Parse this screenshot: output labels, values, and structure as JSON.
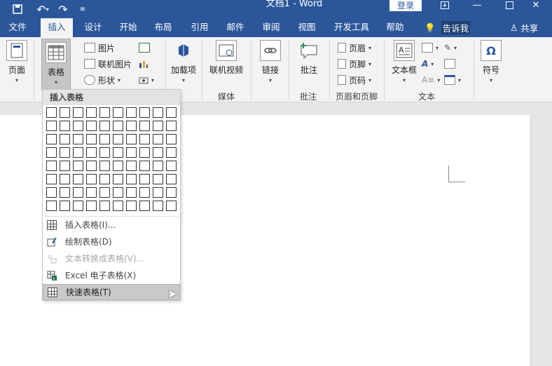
{
  "titlebar": {
    "title": "文档1  -  Word",
    "login": "登录",
    "quick_access": [
      "save-icon",
      "undo-icon",
      "redo-icon",
      "customize-icon"
    ]
  },
  "tabs": [
    {
      "label": "文件",
      "active": false
    },
    {
      "label": "插入",
      "active": true
    },
    {
      "label": "设计",
      "active": false
    },
    {
      "label": "开始",
      "active": false
    },
    {
      "label": "布局",
      "active": false
    },
    {
      "label": "引用",
      "active": false
    },
    {
      "label": "邮件",
      "active": false
    },
    {
      "label": "审阅",
      "active": false
    },
    {
      "label": "视图",
      "active": false
    },
    {
      "label": "开发工具",
      "active": false
    },
    {
      "label": "帮助",
      "active": false
    }
  ],
  "tell_me": "告诉我",
  "share": "共享",
  "ribbon": {
    "page": "页面",
    "table": "表格",
    "picture": "图片",
    "online_picture": "联机图片",
    "shapes": "形状",
    "addins": "加载项",
    "online_video": "联机视频",
    "media_group": "媒体",
    "link": "链接",
    "comment": "批注",
    "comment_group": "批注",
    "header": "页眉",
    "footer": "页脚",
    "page_number": "页码",
    "header_footer_group": "页眉和页脚",
    "textbox": "文本框",
    "text_group": "文本",
    "symbol": "符号"
  },
  "dropdown": {
    "header": "插入表格",
    "grid_cols": 10,
    "grid_rows": 8,
    "items": [
      {
        "label": "插入表格(I)...",
        "disabled": false,
        "icon": "table-icon"
      },
      {
        "label": "绘制表格(D)",
        "disabled": false,
        "icon": "draw-table-icon"
      },
      {
        "label": "文本转换成表格(V)...",
        "disabled": true,
        "icon": "convert-text-icon"
      },
      {
        "label": "Excel 电子表格(X)",
        "disabled": false,
        "icon": "excel-icon"
      },
      {
        "label": "快速表格(T)",
        "disabled": false,
        "icon": "quick-table-icon",
        "hover": true
      }
    ]
  }
}
